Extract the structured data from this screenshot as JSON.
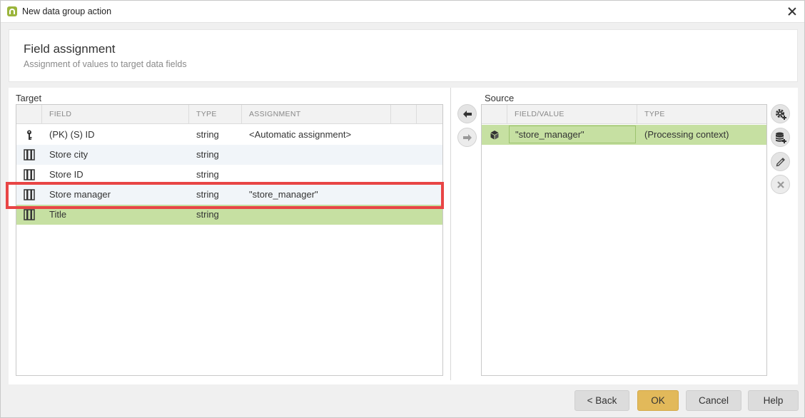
{
  "window": {
    "title": "New data group action"
  },
  "header": {
    "title": "Field assignment",
    "subtitle": "Assignment of values to target data fields"
  },
  "target": {
    "label": "Target",
    "columns": [
      "FIELD",
      "TYPE",
      "ASSIGNMENT"
    ],
    "rows": [
      {
        "icon": "key-icon",
        "field": "(PK) (S) ID",
        "type": "string",
        "assignment": "<Automatic assignment>"
      },
      {
        "icon": "field-icon",
        "field": "Store city",
        "type": "string",
        "assignment": ""
      },
      {
        "icon": "field-icon",
        "field": "Store ID",
        "type": "string",
        "assignment": ""
      },
      {
        "icon": "field-icon",
        "field": "Store manager",
        "type": "string",
        "assignment": "\"store_manager\""
      },
      {
        "icon": "field-icon",
        "field": "Title",
        "type": "string",
        "assignment": ""
      }
    ],
    "selected_row": 4,
    "highlighted_row": 3
  },
  "transfer": {
    "assign_icon": "arrow-left-icon",
    "remove_icon": "arrow-right-icon"
  },
  "source": {
    "label": "Source",
    "columns": [
      "FIELD/VALUE",
      "TYPE"
    ],
    "rows": [
      {
        "icon": "cube-icon",
        "value": "\"store_manager\"",
        "type": "(Processing context)"
      }
    ]
  },
  "source_tools": [
    "gear-add-icon",
    "database-add-icon",
    "pencil-icon",
    "delete-icon"
  ],
  "footer": {
    "back": "< Back",
    "ok": "OK",
    "cancel": "Cancel",
    "help": "Help"
  },
  "colors": {
    "selected_row": "#c6e0a2",
    "alt_row": "#f1f5f9",
    "highlight": "#e84545",
    "primary_button": "#e2b95a",
    "brand": "#9bb53c"
  }
}
